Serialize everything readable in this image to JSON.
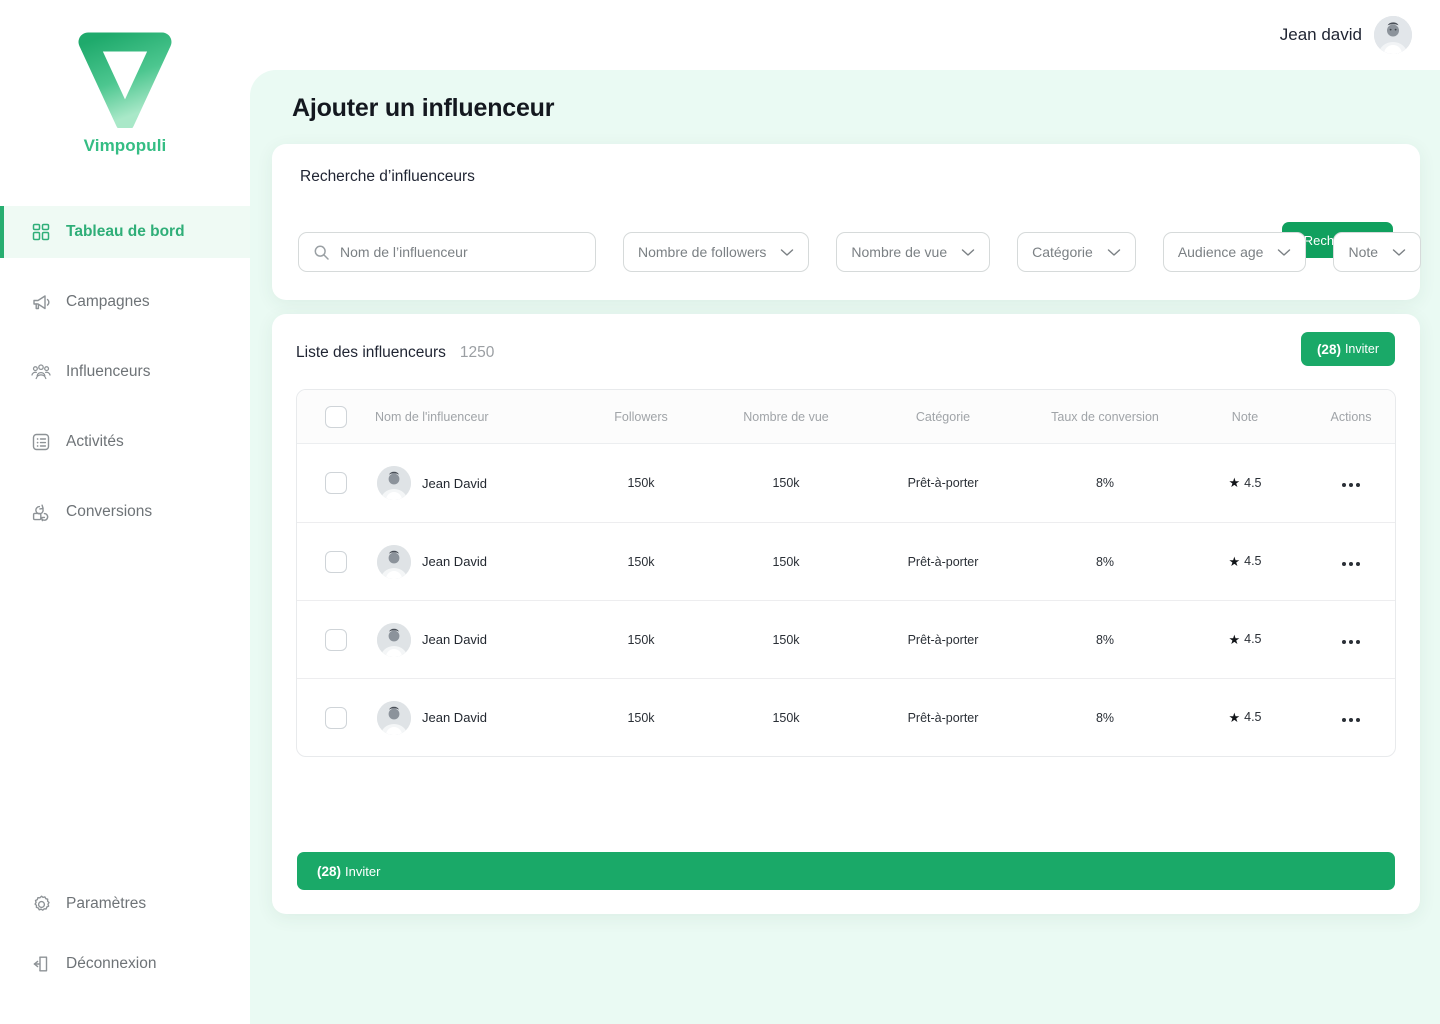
{
  "brand": {
    "name": "Vimpopuli",
    "logo_icon": "v-logo-icon",
    "color_dark": "#27ae70",
    "color_light": "#a8e6c6",
    "accent": "#10a05e"
  },
  "header": {
    "user_name": "Jean david",
    "avatar_icon": "user-avatar"
  },
  "sidebar": {
    "items": [
      {
        "label": "Tableau de bord",
        "icon": "dashboard-icon",
        "key": "tableau-de-bord",
        "active": true
      },
      {
        "label": "Campagnes",
        "icon": "megaphone-icon",
        "key": "campagnes",
        "active": false
      },
      {
        "label": "Influenceurs",
        "icon": "people-group-icon",
        "key": "influenceurs",
        "active": false
      },
      {
        "label": "Activités",
        "icon": "list-icon",
        "key": "activites",
        "active": false
      },
      {
        "label": "Conversions",
        "icon": "conversion-icon",
        "key": "conversions",
        "active": false
      }
    ],
    "bottom_items": [
      {
        "label": "Paramètres",
        "icon": "gear-icon",
        "key": "parametres"
      },
      {
        "label": "Déconnexion",
        "icon": "logout-icon",
        "key": "deconnexion"
      }
    ]
  },
  "main": {
    "page_title": "Ajouter un influenceur"
  },
  "search_panel": {
    "title": "Recherche d’influenceurs",
    "search_button_label": "Rechercher",
    "name_input": {
      "value": "",
      "placeholder": "Nom de l’influenceur",
      "icon": "search-icon"
    },
    "filters": [
      {
        "label": "Nombre de followers",
        "key": "followers",
        "icon": "chevron-down-icon"
      },
      {
        "label": "Nombre de vue",
        "key": "views",
        "icon": "chevron-down-icon"
      },
      {
        "label": "Catégorie",
        "key": "categorie",
        "icon": "chevron-down-icon"
      },
      {
        "label": "Audience age",
        "key": "audience-age",
        "icon": "chevron-down-icon"
      },
      {
        "label": "Note",
        "key": "note",
        "icon": "chevron-down-icon"
      }
    ]
  },
  "list_panel": {
    "title": "Liste des influenceurs",
    "count": "1250",
    "invite_count": "(28)",
    "invite_label": "Inviter",
    "columns": [
      "Nom de l'influenceur",
      "Followers",
      "Nombre de vue",
      "Catégorie",
      "Taux de conversion",
      "Note",
      "Actions"
    ],
    "rows": [
      {
        "name": "Jean David",
        "followers": "150k",
        "views": "150k",
        "category": "Prêt-à-porter",
        "conversion": "8%",
        "note": "4.5",
        "star": "★",
        "actions_icon": "more-dots-icon",
        "checked": false
      },
      {
        "name": "Jean David",
        "followers": "150k",
        "views": "150k",
        "category": "Prêt-à-porter",
        "conversion": "8%",
        "note": "4.5",
        "star": "★",
        "actions_icon": "more-dots-icon",
        "checked": false
      },
      {
        "name": "Jean David",
        "followers": "150k",
        "views": "150k",
        "category": "Prêt-à-porter",
        "conversion": "8%",
        "note": "4.5",
        "star": "★",
        "actions_icon": "more-dots-icon",
        "checked": false
      },
      {
        "name": "Jean David",
        "followers": "150k",
        "views": "150k",
        "category": "Prêt-à-porter",
        "conversion": "8%",
        "note": "4.5",
        "star": "★",
        "actions_icon": "more-dots-icon",
        "checked": false
      }
    ]
  }
}
